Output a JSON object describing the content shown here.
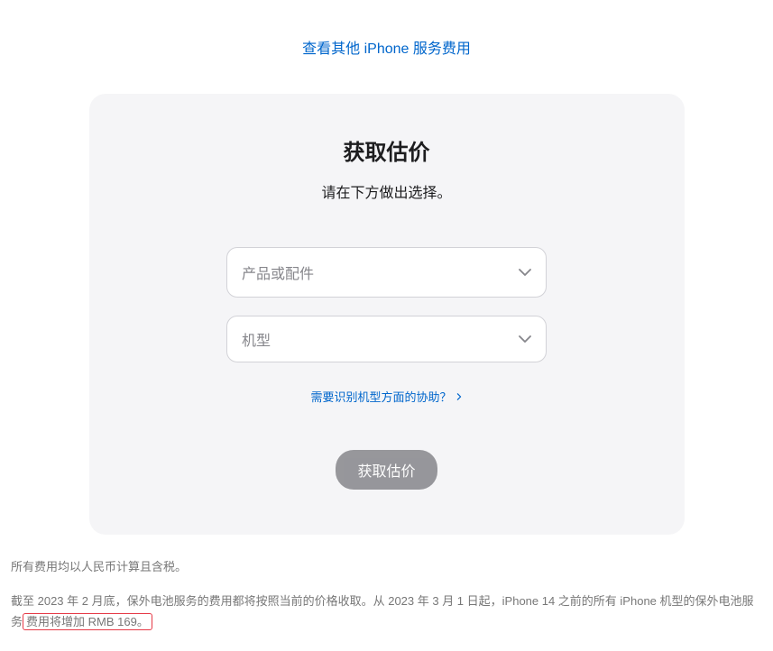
{
  "topLink": "查看其他 iPhone 服务费用",
  "card": {
    "title": "获取估价",
    "subtitle": "请在下方做出选择。",
    "select1": "产品或配件",
    "select2": "机型",
    "helpLink": "需要识别机型方面的协助？",
    "button": "获取估价"
  },
  "footer": {
    "line1": "所有费用均以人民币计算且含税。",
    "line2a": "截至 2023 年 2 月底，保外电池服务的费用都将按照当前的价格收取。从 2023 年 3 月 1 日起，iPhone 14 之前的所有 iPhone 机型的保外电池服务",
    "line2b": "费用将增加 RMB 169。"
  }
}
